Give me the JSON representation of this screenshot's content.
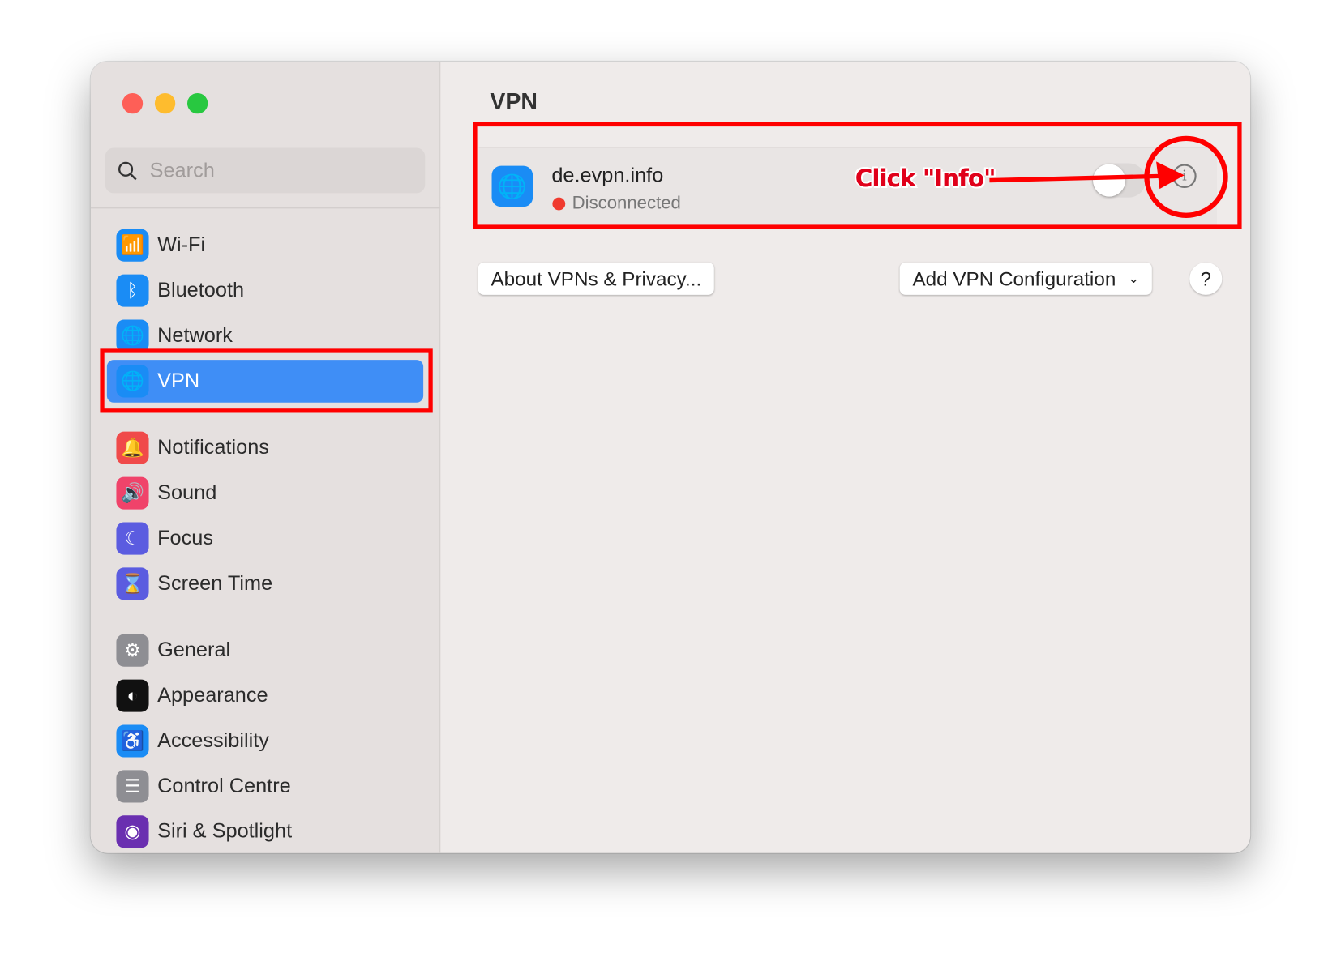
{
  "window": {
    "traffic_lights": {
      "close": "#fe5f57",
      "minimize": "#febc2e",
      "zoom": "#28c840"
    }
  },
  "search": {
    "placeholder": "Search",
    "icon": "magnifier-icon"
  },
  "sidebar": {
    "items": [
      {
        "label": "Wi-Fi",
        "icon": "wifi-icon",
        "color": "#1a8cf5"
      },
      {
        "label": "Bluetooth",
        "icon": "bluetooth-icon",
        "color": "#1a8cf5"
      },
      {
        "label": "Network",
        "icon": "globe-icon",
        "color": "#1a8cf5"
      },
      {
        "label": "VPN",
        "icon": "vpn-globe-shield-icon",
        "color": "#1a8cf5",
        "selected": true
      },
      {
        "label": "Notifications",
        "icon": "bell-icon",
        "color": "#f04a4a"
      },
      {
        "label": "Sound",
        "icon": "speaker-icon",
        "color": "#f0436a"
      },
      {
        "label": "Focus",
        "icon": "moon-icon",
        "color": "#5b5ce0"
      },
      {
        "label": "Screen Time",
        "icon": "hourglass-icon",
        "color": "#5b5ce0"
      },
      {
        "label": "General",
        "icon": "gear-icon",
        "color": "#8e8e93"
      },
      {
        "label": "Appearance",
        "icon": "appearance-icon",
        "color": "#111111"
      },
      {
        "label": "Accessibility",
        "icon": "accessibility-icon",
        "color": "#1a8cf5"
      },
      {
        "label": "Control Centre",
        "icon": "switches-icon",
        "color": "#8e8e93"
      },
      {
        "label": "Siri & Spotlight",
        "icon": "siri-icon",
        "color": "#6a2fb0"
      }
    ]
  },
  "main": {
    "title": "VPN",
    "vpn": {
      "name": "de.evpn.info",
      "status": "Disconnected",
      "status_color": "#f03a2e",
      "enabled": false
    },
    "about_button": "About VPNs & Privacy...",
    "add_button": "Add VPN Configuration",
    "help_button": "?"
  },
  "annotation": {
    "text": "Click \"Info\"",
    "color": "#ff0000"
  }
}
